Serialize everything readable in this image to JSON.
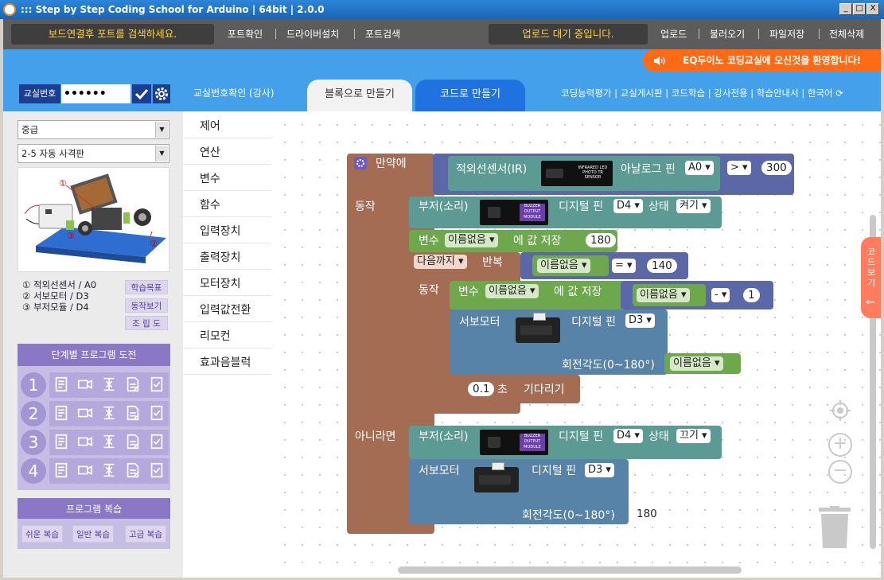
{
  "window": {
    "title": "::: Step by Step Coding School for Arduino | 64bit | 2.0.0",
    "min": "_",
    "max": "□",
    "close": "X"
  },
  "menubar": {
    "connect_msg": "보드연결후 포트를 검색하세요.",
    "left_links": [
      "포트확인",
      "드라이버설치",
      "포트검색"
    ],
    "upload_status": "업로드 대기 중입니다.",
    "right_links": [
      "업로드",
      "불러오기",
      "파일저장",
      "전체삭제"
    ]
  },
  "welcome": "EQ두이노 코딩교실에 오신것을 환영합니다!",
  "classroom": {
    "label": "교실번호",
    "value": "••••••"
  },
  "teacher_confirm": "교실번호확인 (강사)",
  "tabs": {
    "block": "블록으로 만들기",
    "code": "코드로 만들기"
  },
  "top_links": [
    "코딩능력평가",
    "교실게시판",
    "코드학습",
    "강사전용",
    "학습안내서",
    "한국어"
  ],
  "left": {
    "level": "중급",
    "lesson": "2-5 자동 사격판",
    "parts": [
      "① 적외선센서 / A0",
      "② 서보모터 / D3",
      "③ 부저모듈 / D4"
    ],
    "buttons": [
      "학습목표",
      "동작보기",
      "조 립 도"
    ],
    "stage_title": "단계별 프로그램 도전",
    "stages": [
      "1",
      "2",
      "3",
      "4"
    ],
    "review_title": "프로그램 복습",
    "review_buttons": [
      "쉬운 복습",
      "일반 복습",
      "고급 복습"
    ]
  },
  "categories": [
    "제어",
    "연산",
    "변수",
    "함수",
    "입력장치",
    "출력장치",
    "모터장치",
    "입력값전환",
    "리모컨",
    "효과음블럭"
  ],
  "blocks": {
    "if_label": "만약에",
    "ir_sensor": "적외선센서(IR)",
    "analog_pin": "아날로그 핀",
    "pin_a0": "A0",
    "gt_op": ">",
    "threshold": "300",
    "do_label": "동작",
    "buzzer": "부저(소리)",
    "digital_pin": "디지털 핀",
    "pin_d4": "D4",
    "state": "상태",
    "state_on": "켜기",
    "var_label": "변수",
    "var_name": "이름없음",
    "set_value": "에 값 저장",
    "init_value": "180",
    "until": "다음까지",
    "repeat": "반복",
    "eq_op": "=",
    "target": "140",
    "minus_op": "-",
    "step": "1",
    "servo": "서보모터",
    "pin_d3": "D3",
    "angle": "회전각도(0~180°)",
    "wait_value": "0.1",
    "sec": "초",
    "wait": "기다리기",
    "else_label": "아니라면",
    "state_off": "끄기",
    "angle_value": "180",
    "ir_chip": "INFRARED LED PHOTO TR SENSOR",
    "buzzer_chip": "BUZZER OUTPUT MODULE"
  },
  "code_view": "코드보기"
}
